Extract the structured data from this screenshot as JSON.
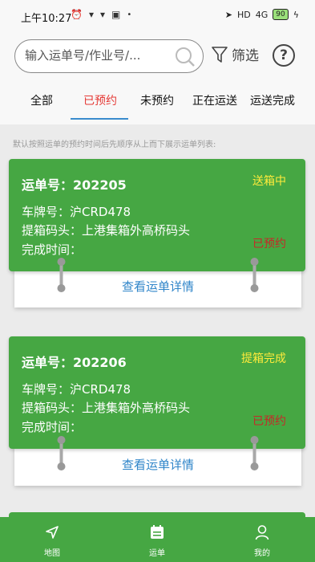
{
  "status_bar": {
    "time": "上午10:27",
    "network": "4G",
    "battery": "90"
  },
  "search": {
    "placeholder": "输入运单号/作业号/..."
  },
  "filter_label": "筛选",
  "help_label": "?",
  "tabs": [
    {
      "label": "全部",
      "active": false
    },
    {
      "label": "已预约",
      "active": true
    },
    {
      "label": "未预约",
      "active": false
    },
    {
      "label": "正在运送",
      "active": false
    },
    {
      "label": "运送完成",
      "active": false
    }
  ],
  "hint": "默认按照运单的预约时间后先顺序从上而下展示运单列表:",
  "orders": [
    {
      "order_no": "运单号：202205",
      "plate": "车牌号：沪CRD478",
      "terminal": "提箱码头：上港集箱外高桥码头",
      "finish_time": "完成时间：",
      "status": "送箱中",
      "reservation": "已预约",
      "detail_link": "查看运单详情"
    },
    {
      "order_no": "运单号：202206",
      "plate": "车牌号：沪CRD478",
      "terminal": "提箱码头：上港集箱外高桥码头",
      "finish_time": "完成时间：",
      "status": "提箱完成",
      "reservation": "已预约",
      "detail_link": "查看运单详情"
    }
  ],
  "bottom_nav": [
    {
      "label": "地图",
      "icon": "navigation-arrow-icon"
    },
    {
      "label": "运单",
      "icon": "calendar-list-icon"
    },
    {
      "label": "我的",
      "icon": "person-icon"
    }
  ],
  "colors": {
    "card_green": "#46a743",
    "status_yellow": "#ffeb3b",
    "reserved_red": "#c62828",
    "active_tab_red": "#e53935",
    "link_blue": "#2f85c9"
  }
}
